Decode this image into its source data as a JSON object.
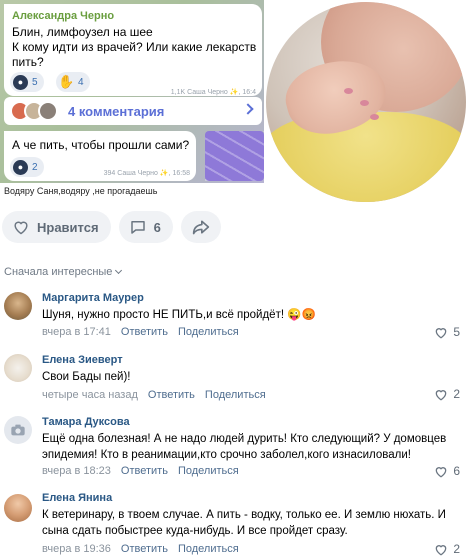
{
  "collage": {
    "chat": {
      "author": "Александра Черно",
      "message1": "Блин, лимфоузел на шее\nК кому идти из врачей? Или какие лекарств\nпить?",
      "reaction1_count": "5",
      "reaction2_count": "4",
      "meta1": "1,1K Саша Черно ✨, 16:4",
      "comments_label": "4 комментария",
      "message2": "А че пить, чтобы прошли сами?",
      "reaction3_count": "2",
      "meta2": "394 Саша Черно ✨, 16:58",
      "caption": "Водяру Саня,водяру ,не прогадаешь"
    }
  },
  "actions": {
    "like_label": "Нравится",
    "comments_count": "6"
  },
  "sort_label": "Сначала интересные",
  "comments": [
    {
      "name": "Маргарита Маурер",
      "text": "Шуня, нужно просто НЕ ПИТЬ,и всё пройдёт! 😜😡",
      "time": "вчера в 17:41",
      "reply": "Ответить",
      "share": "Поделиться",
      "likes": "5"
    },
    {
      "name": "Елена Зиеверт",
      "text": "Свои Бады пей)!",
      "time": "четыре часа назад",
      "reply": "Ответить",
      "share": "Поделиться",
      "likes": "2"
    },
    {
      "name": "Тамара Дуксова",
      "text": "Ещё одна болезная! А не надо людей дурить! Кто следующий? У домовцев эпидемия! Кто в реанимации,кто срочно заболел,кого изнасиловали!",
      "time": "вчера в 18:23",
      "reply": "Ответить",
      "share": "Поделиться",
      "likes": "6"
    },
    {
      "name": "Елена Янина",
      "text": "К ветеринару, в твоем случае. А пить - водку, только ее. И землю нюхать. И сына сдать побыстрее куда-нибудь. И все пройдет сразу.",
      "time": "вчера в 19:36",
      "reply": "Ответить",
      "share": "Поделиться",
      "likes": "2"
    }
  ],
  "colors": {
    "name_link": "#2a5885",
    "accent": "#5b6fd6",
    "meta": "#8a939d"
  }
}
